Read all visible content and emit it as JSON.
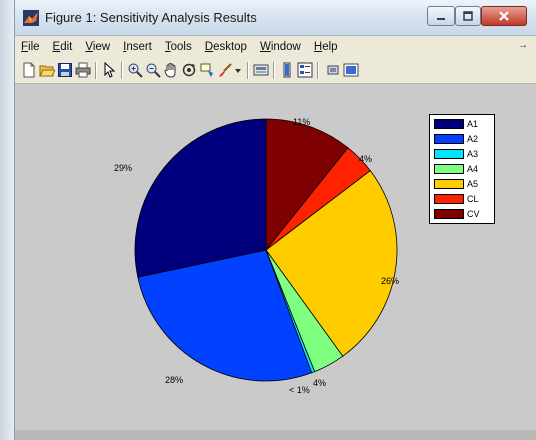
{
  "window": {
    "title": "Figure 1: Sensitivity Analysis Results"
  },
  "menu": {
    "items": [
      {
        "first": "F",
        "rest": "ile"
      },
      {
        "first": "E",
        "rest": "dit"
      },
      {
        "first": "V",
        "rest": "iew"
      },
      {
        "first": "I",
        "rest": "nsert"
      },
      {
        "first": "T",
        "rest": "ools"
      },
      {
        "first": "D",
        "rest": "esktop"
      },
      {
        "first": "W",
        "rest": "indow"
      },
      {
        "first": "H",
        "rest": "elp"
      }
    ],
    "overflow_arrow": "→"
  },
  "toolbar": {
    "icons": [
      "new-figure-icon",
      "open-file-icon",
      "save-icon",
      "print-icon",
      "edit-plot-arrow-icon",
      "zoom-in-icon",
      "zoom-out-icon",
      "pan-hand-icon",
      "rotate-3d-icon",
      "data-cursor-icon",
      "brush-icon",
      "brush-dropdown-icon",
      "link-plot-icon",
      "colorbar-icon",
      "legend-icon",
      "hide-plot-tools-icon",
      "show-plot-tools-icon"
    ]
  },
  "chart_data": {
    "type": "pie",
    "categories": [
      "A1",
      "A2",
      "A3",
      "A4",
      "A5",
      "CL",
      "CV"
    ],
    "values": [
      29,
      28,
      0.4,
      4,
      26,
      4,
      11
    ],
    "colors": [
      "#00007f",
      "#0042ff",
      "#00e5ff",
      "#7fff7f",
      "#ffcc00",
      "#ff2200",
      "#7f0000"
    ],
    "labels": {
      "A1": "29%",
      "A2": "28%",
      "A3": "< 1%",
      "A4": "4%",
      "A5": "26%",
      "CL": "4%",
      "CV": "11%"
    },
    "legend_position": "top-right"
  }
}
